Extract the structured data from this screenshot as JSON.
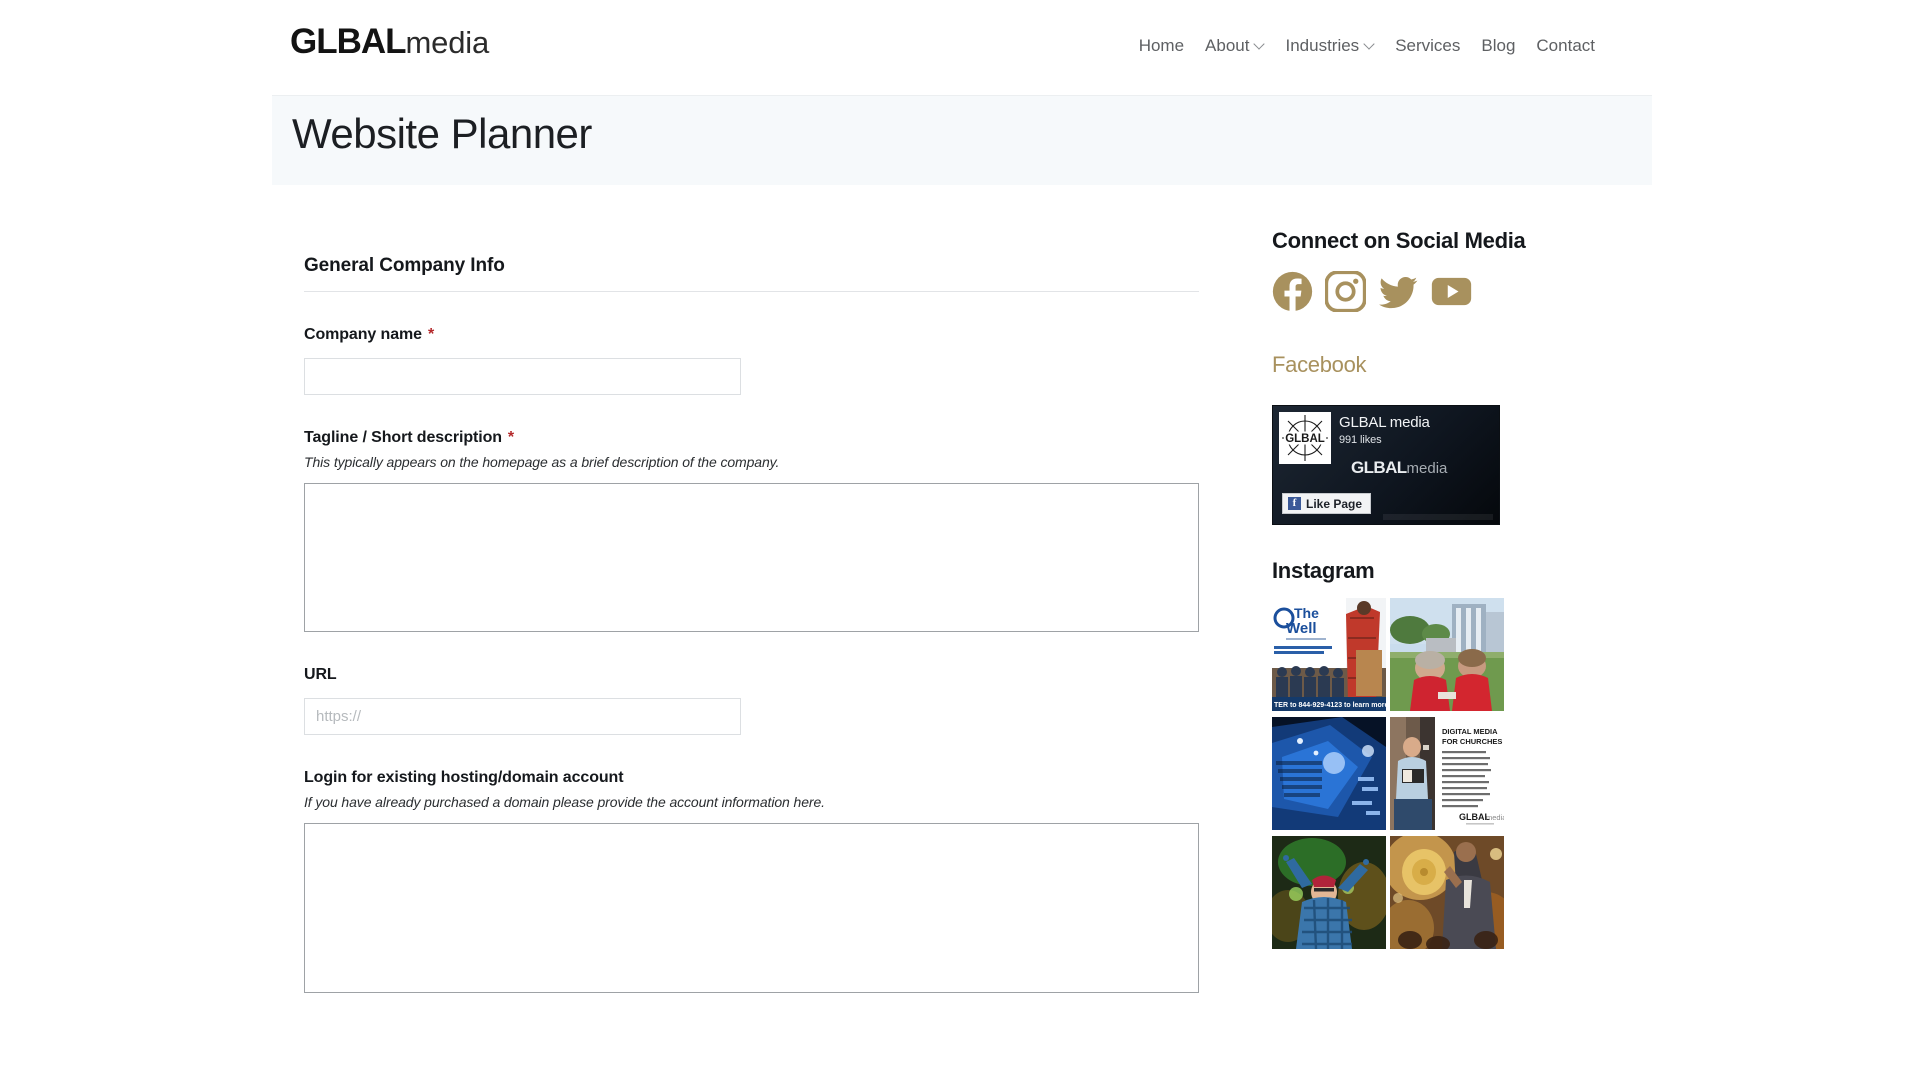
{
  "header": {
    "logo": {
      "bold": "GLBAL",
      "light": "media"
    },
    "nav": [
      {
        "label": "Home",
        "caret": false
      },
      {
        "label": "About",
        "caret": true
      },
      {
        "label": "Industries",
        "caret": true
      },
      {
        "label": "Services",
        "caret": false
      },
      {
        "label": "Blog",
        "caret": false
      },
      {
        "label": "Contact",
        "caret": false
      }
    ]
  },
  "banner": {
    "title": "Website Planner"
  },
  "form": {
    "section_heading": "General Company Info",
    "company_name": {
      "label": "Company name",
      "required": "*",
      "value": "",
      "placeholder": ""
    },
    "tagline": {
      "label": "Tagline / Short description",
      "required": "*",
      "help": "This typically appears on the homepage as a brief description of the company.",
      "value": "",
      "placeholder": ""
    },
    "url": {
      "label": "URL",
      "value": "",
      "placeholder": "https://"
    },
    "hosting_login": {
      "label": "Login for existing hosting/domain account",
      "help": "If you have already purchased a domain please provide the account information here.",
      "value": "",
      "placeholder": ""
    }
  },
  "sidebar": {
    "social_heading": "Connect on Social Media",
    "social_links": [
      {
        "name": "facebook-icon",
        "label": "Facebook"
      },
      {
        "name": "instagram-icon",
        "label": "Instagram"
      },
      {
        "name": "twitter-icon",
        "label": "Twitter"
      },
      {
        "name": "youtube-icon",
        "label": "YouTube"
      }
    ],
    "facebook_heading": "Facebook",
    "facebook_widget": {
      "page_name": "GLBAL media",
      "likes": "991 likes",
      "wordmark_bold": "GLBAL",
      "wordmark_light": "media",
      "avatar_text": "GLBAL",
      "like_button": "Like Page"
    },
    "instagram_heading": "Instagram",
    "instagram_posts": [
      {
        "alt": "The Well clean water campaign poster with speaker and group"
      },
      {
        "alt": "Two women in red shirts talking on a field"
      },
      {
        "alt": "Blue lit arena concert aerial view"
      },
      {
        "alt": "Digital Media for Churches article image with man reading"
      },
      {
        "alt": "Performer in plaid shirt with arms raised on green lit stage"
      },
      {
        "alt": "Drummer with golden cymbal on warm lit stage"
      }
    ]
  },
  "colors": {
    "gold": "#a8915e",
    "required_red": "#b4292b",
    "banner_bg": "#f6f9fb",
    "text_dark": "#15181c",
    "nav_gray": "#5e6063"
  }
}
